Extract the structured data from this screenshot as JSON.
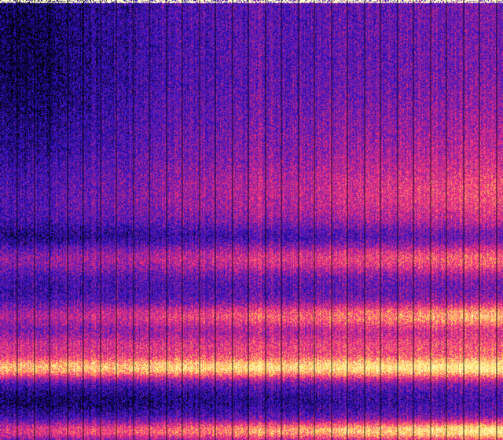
{
  "image": {
    "kind": "spectrogram",
    "colormap": [
      "#000000",
      "#1a0a9a",
      "#3a14c8",
      "#7a1eb0",
      "#c4287a",
      "#ff2e8a",
      "#ff7a6a",
      "#ffd24a",
      "#fff8b0"
    ],
    "divider_color": "#000000",
    "top_edge_color": "#ffffcc"
  }
}
